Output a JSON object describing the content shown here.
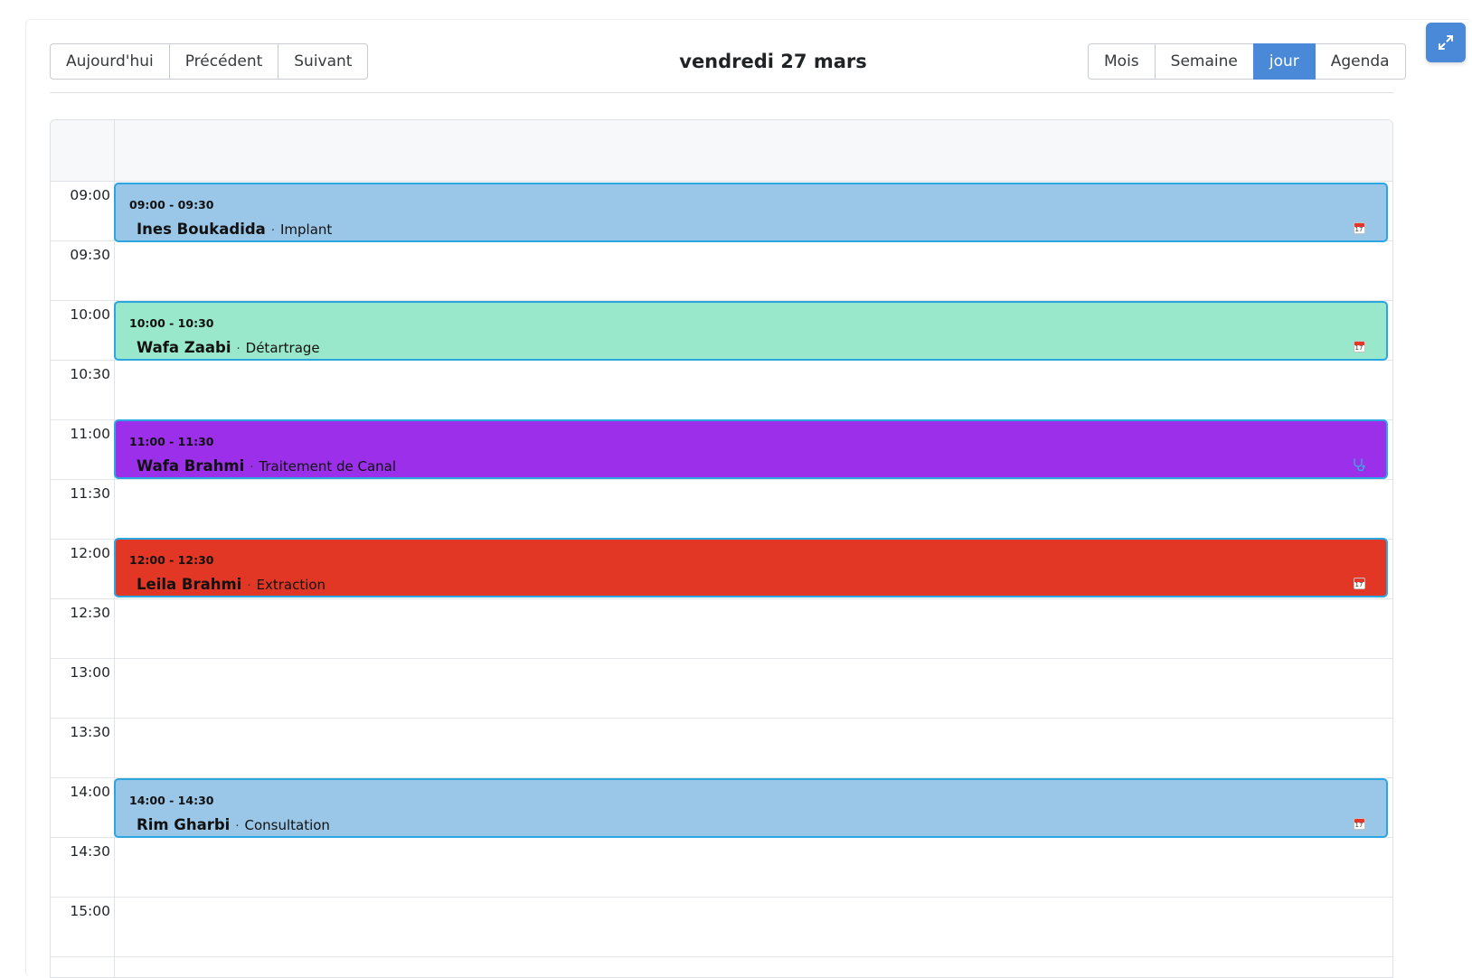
{
  "toolbar": {
    "today_label": "Aujourd'hui",
    "prev_label": "Précédent",
    "next_label": "Suivant",
    "title": "vendredi 27 mars",
    "views": [
      {
        "label": "Mois",
        "active": false
      },
      {
        "label": "Semaine",
        "active": false
      },
      {
        "label": "jour",
        "active": true
      },
      {
        "label": "Agenda",
        "active": false
      }
    ],
    "expand_icon": "expand-arrows-icon"
  },
  "timeslots": [
    "09:00",
    "09:30",
    "10:00",
    "10:30",
    "11:00",
    "11:30",
    "12:00",
    "12:30",
    "13:00",
    "13:30",
    "14:00",
    "14:30",
    "15:00"
  ],
  "events": [
    {
      "time": "09:00 - 09:30",
      "patient": "Ines Boukadida",
      "separator": "·",
      "type": "Implant",
      "color": "#9ac7e8",
      "icon": "calendar-icon"
    },
    {
      "time": "10:00 - 10:30",
      "patient": "Wafa Zaabi",
      "separator": "·",
      "type": "Détartrage",
      "color": "#9ae8cc",
      "icon": "calendar-icon"
    },
    {
      "time": "11:00 - 11:30",
      "patient": "Wafa Brahmi",
      "separator": "·",
      "type": "Traitement de Canal",
      "color": "#9b2fea",
      "icon": "stethoscope-icon"
    },
    {
      "time": "12:00 - 12:30",
      "patient": "Leila Brahmi",
      "separator": "·",
      "type": "Extraction",
      "color": "#e33726",
      "icon": "calendar-icon"
    },
    {
      "time": "14:00 - 14:30",
      "patient": "Rim Gharbi",
      "separator": "·",
      "type": "Consultation",
      "color": "#9ac7e8",
      "icon": "calendar-icon"
    }
  ]
}
